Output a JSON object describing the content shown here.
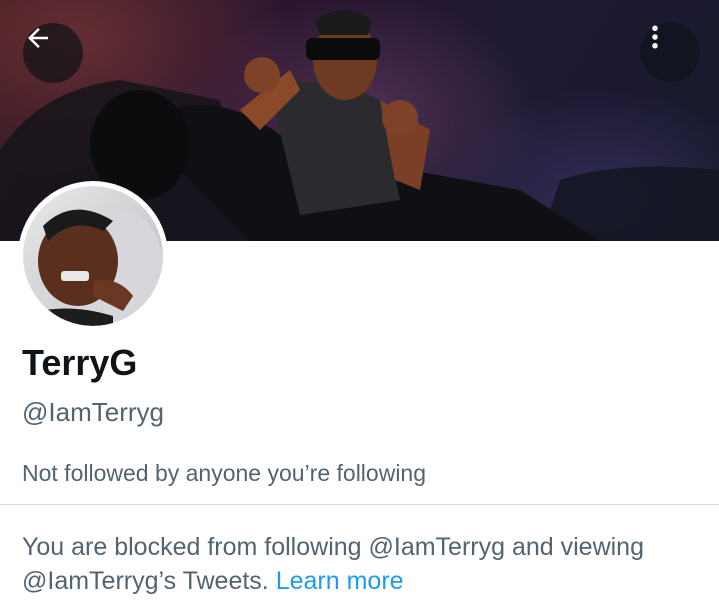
{
  "header": {
    "back_icon": "arrow-left-icon",
    "more_icon": "more-vertical-icon",
    "banner_colors": [
      "#3b1c22",
      "#2a1630",
      "#1e1a33",
      "#171a2c"
    ]
  },
  "profile": {
    "display_name": "TerryG",
    "handle": "@IamTerryg",
    "followers_you_know": "Not followed by anyone you’re following"
  },
  "blocked_notice": {
    "text": "You are blocked from following @IamTerryg and viewing @IamTerryg’s Tweets.",
    "link_label": "Learn more",
    "link_color": "#1d9bf0"
  }
}
